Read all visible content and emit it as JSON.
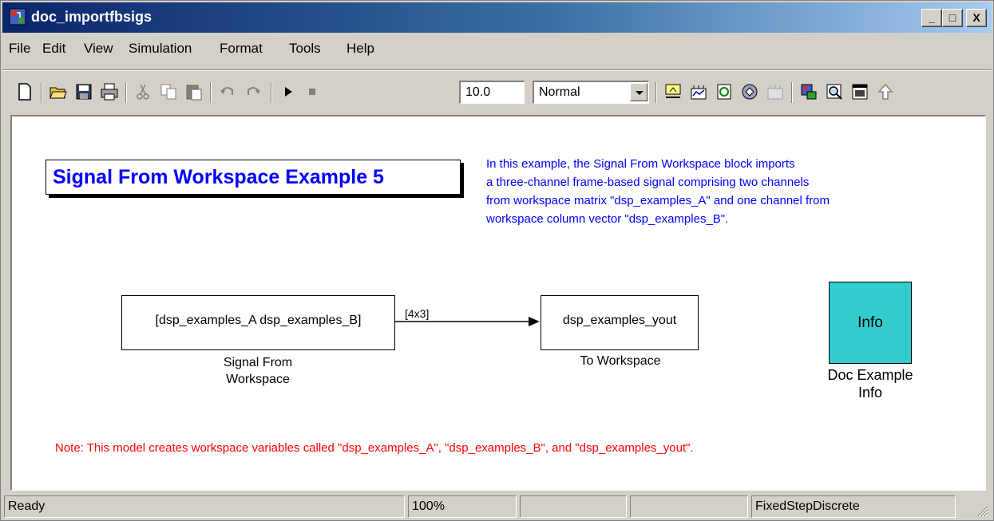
{
  "window": {
    "title": "doc_importfbsigs",
    "minimize_glyph": "_",
    "maximize_glyph": "□",
    "close_glyph": "X"
  },
  "menu": [
    "File",
    "Edit",
    "View",
    "Simulation",
    "Format",
    "Tools",
    "Help"
  ],
  "toolbar": {
    "stop_time": "10.0",
    "sim_mode": "Normal",
    "icons": [
      "new-icon",
      "open-icon",
      "save-icon",
      "print-icon",
      "cut-icon",
      "copy-icon",
      "paste-icon",
      "undo-icon",
      "redo-icon",
      "run-icon",
      "stop-icon",
      "build-icon",
      "update-diagram-icon",
      "refresh-icon",
      "library-browser-icon",
      "model-explorer-icon",
      "debugger-icon",
      "go-to-parent-icon"
    ]
  },
  "canvas": {
    "title": "Signal From Workspace Example 5",
    "description": [
      "In this example, the Signal From Workspace block imports",
      "a three-channel frame-based signal comprising two channels",
      "from workspace matrix \"dsp_examples_A\" and one channel from",
      "workspace column vector \"dsp_examples_B\"."
    ],
    "blocks": {
      "signal_from_workspace": {
        "content": "[dsp_examples_A dsp_examples_B]",
        "label_line1": "Signal From",
        "label_line2": "Workspace"
      },
      "signal_dims": "[4x3]",
      "to_workspace": {
        "content": "dsp_examples_yout",
        "label": "To Workspace"
      },
      "info": {
        "content": "Info",
        "label_line1": "Doc Example",
        "label_line2": "Info",
        "color": "#33cccc"
      }
    },
    "note": "Note: This model creates workspace variables called \"dsp_examples_A\", \"dsp_examples_B\", and \"dsp_examples_yout\"."
  },
  "status": {
    "state": "Ready",
    "zoom": "100%",
    "pane3": "",
    "pane4": "",
    "solver": "FixedStepDiscrete"
  },
  "colors": {
    "title_text": "#0000ff",
    "note_text": "#ff0000",
    "info_block": "#33cccc"
  }
}
